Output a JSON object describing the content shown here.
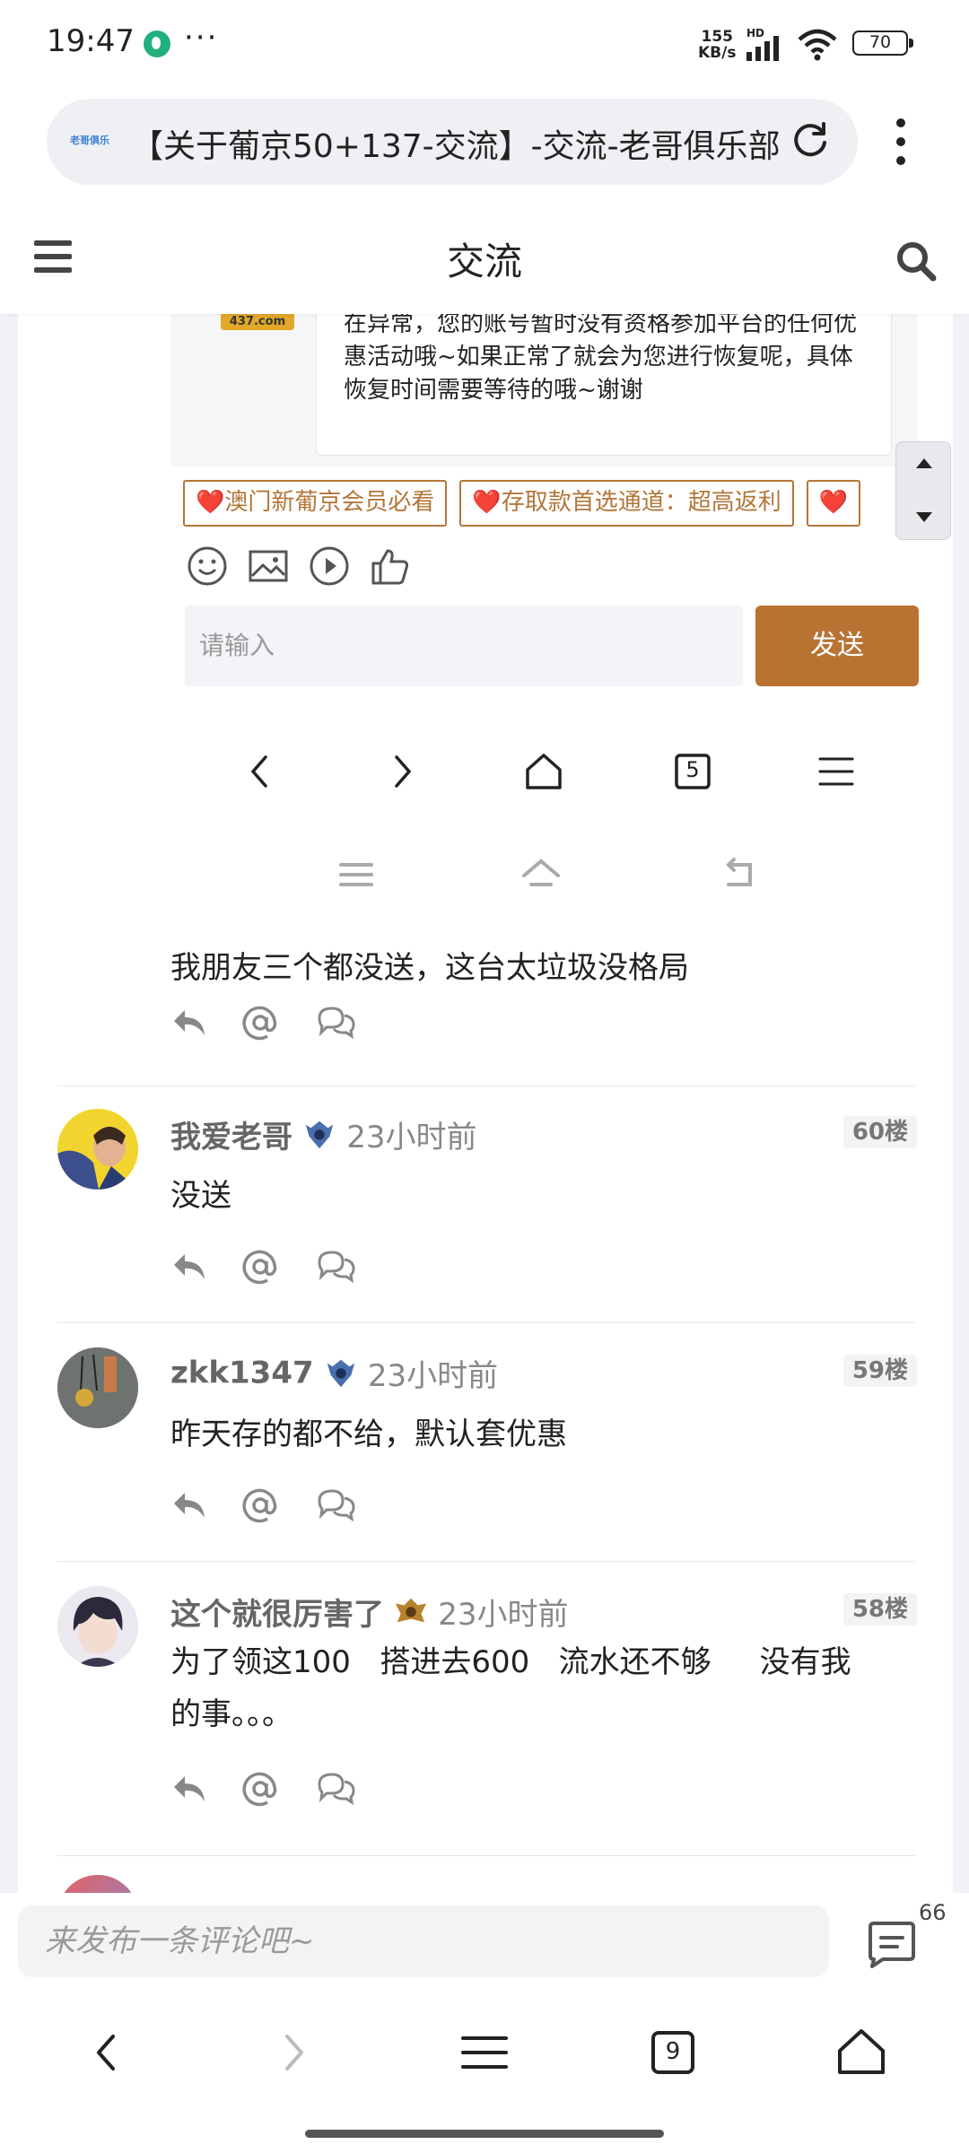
{
  "status_bar": {
    "time": "19:47",
    "net_speed_value": "155",
    "net_speed_unit": "KB/s",
    "hd_label": "HD",
    "battery": "70"
  },
  "browser": {
    "page_title": "【关于葡京50+137-交流】-交流-老哥俱乐部",
    "favicon_text": "老哥俱乐"
  },
  "header": {
    "title": "交流"
  },
  "quoted_reply": {
    "logo_text": "437.com",
    "text": "在异常，您的账号暂时没有资格参加平台的任何优惠活动哦~如果正常了就会为您进行恢复呢，具体恢复时间需要等待的哦~谢谢"
  },
  "tags": [
    {
      "heart": "❤️",
      "label": "澳门新葡京会员必看"
    },
    {
      "heart": "❤️",
      "label": "存取款首选通道：超高返利"
    },
    {
      "heart": "❤️",
      "label": ""
    }
  ],
  "reply_box": {
    "placeholder": "请输入",
    "send_label": "发送",
    "inner_tab_count": "5"
  },
  "comments": [
    {
      "text": "我朋友三个都没送，这台太垃圾没格局"
    },
    {
      "user": "我爱老哥",
      "time": "23小时前",
      "floor": "60楼",
      "text": "没送"
    },
    {
      "user": "zkk1347",
      "time": "23小时前",
      "floor": "59楼",
      "text": "昨天存的都不给，默认套优惠"
    },
    {
      "user": "这个就很厉害了",
      "time": "23小时前",
      "floor": "58楼",
      "text_line1": "为了领这100   搭进去600   流水还不够     没有我",
      "text_line2": "的事。。。"
    }
  ],
  "bottom_bar": {
    "placeholder": "来发布一条评论吧~",
    "comment_count": "66"
  },
  "browser_nav": {
    "tab_count": "9"
  },
  "colors": {
    "accent": "#b87333",
    "tag_border": "#b27639",
    "heart": "#e0252b"
  }
}
